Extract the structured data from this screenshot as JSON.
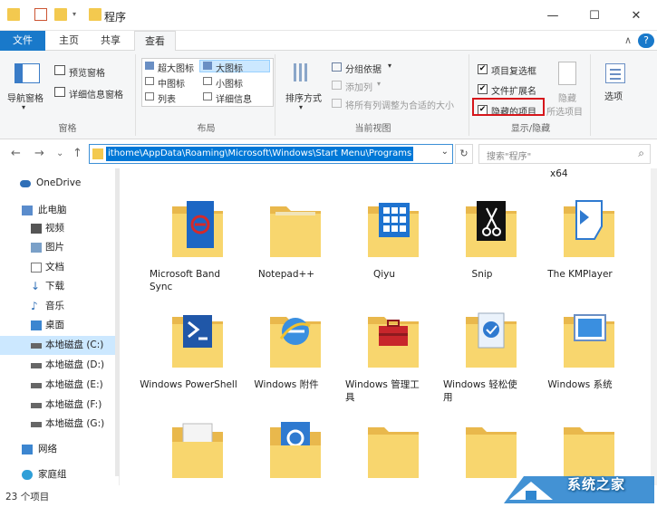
{
  "window": {
    "title": "程序",
    "minimize_glyph": "—",
    "maximize_glyph": "☐",
    "close_glyph": "✕",
    "collapse_glyph": "∧",
    "help_glyph": "?"
  },
  "tabs": [
    {
      "label": "文件"
    },
    {
      "label": "主页"
    },
    {
      "label": "共享"
    },
    {
      "label": "查看"
    }
  ],
  "ribbon": {
    "panes": {
      "navigation_pane": "导航窗格",
      "preview_pane": "预览窗格",
      "details_pane": "详细信息窗格",
      "group_label": "窗格"
    },
    "layout": {
      "extra_large": "超大图标",
      "large": "大图标",
      "medium": "中图标",
      "small": "小图标",
      "list": "列表",
      "details": "详细信息",
      "group_label": "布局"
    },
    "current_view": {
      "sort_by": "排序方式",
      "group_by": "分组依据",
      "add_columns": "添加列",
      "fit_columns": "将所有列调整为合适的大小",
      "group_label": "当前视图"
    },
    "show_hide": {
      "item_checkboxes": "项目复选框",
      "file_extensions": "文件扩展名",
      "hidden_items": "隐藏的项目",
      "hide_selected_1": "隐藏",
      "hide_selected_2": "所选项目",
      "group_label": "显示/隐藏",
      "check_glyph": "✔"
    },
    "options": "选项"
  },
  "address": {
    "path": "ithome\\AppData\\Roaming\\Microsoft\\Windows\\Start Menu\\Programs",
    "search_placeholder": "搜索\"程序\"",
    "back_glyph": "←",
    "forward_glyph": "→",
    "recent_glyph": "⌄",
    "up_glyph": "↑",
    "dropdown_glyph": "⌄",
    "refresh_glyph": "↻",
    "search_glyph": "⌕"
  },
  "sidebar": {
    "items": [
      {
        "label": "OneDrive"
      },
      {
        "label": "此电脑"
      },
      {
        "label": "视频"
      },
      {
        "label": "图片"
      },
      {
        "label": "文档"
      },
      {
        "label": "下载"
      },
      {
        "label": "音乐"
      },
      {
        "label": "桌面"
      },
      {
        "label": "本地磁盘 (C:)"
      },
      {
        "label": "本地磁盘 (D:)"
      },
      {
        "label": "本地磁盘 (E:)"
      },
      {
        "label": "本地磁盘 (F:)"
      },
      {
        "label": "本地磁盘 (G:)"
      },
      {
        "label": "网络"
      },
      {
        "label": "家庭组"
      }
    ]
  },
  "content": {
    "stray_label": "x64",
    "items": [
      {
        "name": "Microsoft Band Sync"
      },
      {
        "name": "Notepad++"
      },
      {
        "name": "Qiyu"
      },
      {
        "name": "Snip"
      },
      {
        "name": "The KMPlayer"
      },
      {
        "name": "Windows PowerShell"
      },
      {
        "name": "Windows 附件"
      },
      {
        "name": "Windows 管理工具"
      },
      {
        "name": "Windows 轻松使用"
      },
      {
        "name": "Windows 系统"
      }
    ]
  },
  "status": {
    "count": "23 个项目"
  },
  "watermark": {
    "text": "系统之家"
  }
}
